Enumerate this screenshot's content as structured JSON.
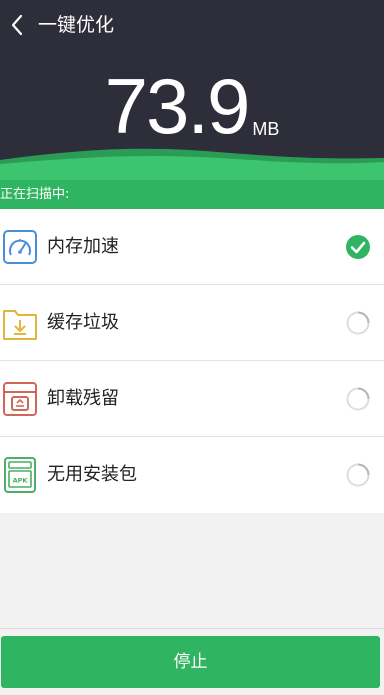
{
  "header": {
    "title": "一键优化",
    "size_value": "73.9",
    "size_unit": "MB"
  },
  "status": {
    "text": "正在扫描中:"
  },
  "items": [
    {
      "label": "内存加速",
      "icon": "speedometer-icon",
      "state": "done"
    },
    {
      "label": "缓存垃圾",
      "icon": "folder-download-icon",
      "state": "scanning"
    },
    {
      "label": "卸载残留",
      "icon": "uninstall-box-icon",
      "state": "scanning"
    },
    {
      "label": "无用安装包",
      "icon": "apk-package-icon",
      "state": "scanning"
    }
  ],
  "footer": {
    "stop_label": "停止"
  },
  "colors": {
    "header_bg": "#2e2d3a",
    "accent_green": "#2fb561",
    "wave_green": "#3cc46e",
    "icon_blue": "#4a8ed8",
    "icon_yellow": "#e2b53c",
    "icon_red": "#d0685a",
    "icon_green": "#4cae67"
  }
}
